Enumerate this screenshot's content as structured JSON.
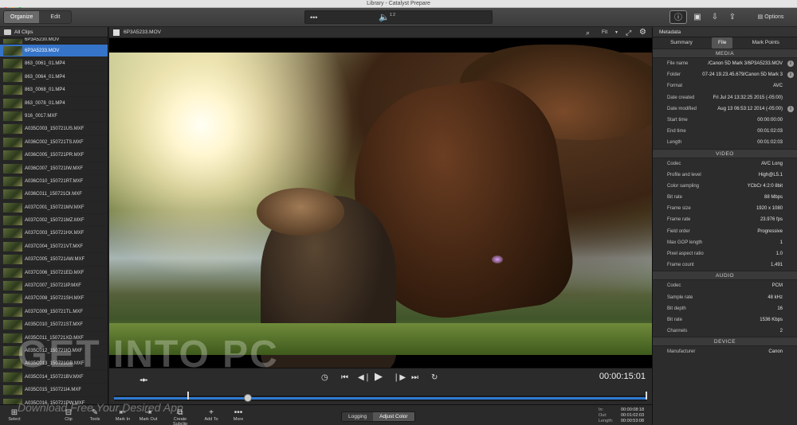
{
  "window": {
    "title": "Library - Catalyst Prepare"
  },
  "toolbar": {
    "modes": [
      "Organize",
      "Edit"
    ],
    "active_mode": "Organize",
    "center_more": "•••",
    "options_label": "Options",
    "audio_channels": "1 2"
  },
  "sidebar": {
    "header": "All Clips",
    "clips": [
      "6P3A5230.MOV",
      "6P3A5233.MOV",
      "863_0061_01.MP4",
      "863_0064_01.MP4",
      "863_0068_01.MP4",
      "863_0078_01.MP4",
      "916_0017.MXF",
      "A035C003_150721US.MXF",
      "A036C002_150721TS.MXF",
      "A036C005_150721PR.MXF",
      "A036C007_150721IW.MXF",
      "A036C010_150721RT.MXF",
      "A036C011_150721OI.MXF",
      "A037C001_150721MV.MXF",
      "A037C002_150721MZ.MXF",
      "A037C003_150721HX.MXF",
      "A037C004_150721VT.MXF",
      "A037C005_150721AW.MXF",
      "A037C006_150721ED.MXF",
      "A037C007_150721IP.MXF",
      "A037C008_150721SH.MXF",
      "A037C009_150721TL.MXF",
      "A035C010_150721ST.MXF",
      "A035C011_150721XD.MXF",
      "A035C012_150721IO.MXF",
      "A035C013_150721GB.MXF",
      "A035C014_150721BV.MXF",
      "A035C015_150721I4.MXF",
      "A035C016_150721PW.MXF"
    ],
    "selected_index": 1
  },
  "viewer": {
    "clip_name": "6P3A5233.MOV",
    "zoom": "Fit",
    "timecode": "00:00:15:01"
  },
  "bottom_tools": [
    {
      "label": "Select",
      "icon": "grid-icon"
    },
    {
      "label": "Clip",
      "icon": "clip-icon"
    },
    {
      "label": "Tools",
      "icon": "tools-icon"
    },
    {
      "label": "Mark In",
      "icon": "mark-in-icon"
    },
    {
      "label": "Mark Out",
      "icon": "mark-out-icon"
    },
    {
      "label": "Create Subclip",
      "icon": "subclip-icon"
    },
    {
      "label": "Add To",
      "icon": "plus-icon"
    },
    {
      "label": "More",
      "icon": "more-icon"
    }
  ],
  "modes": [
    "Logging",
    "Adjust Color"
  ],
  "active_bottom_mode": "Adjust Color",
  "io": {
    "in_label": "In:",
    "in": "00:00:08:18",
    "out_label": "Out:",
    "out": "00:01:02:03",
    "length_label": "Length:",
    "length": "00:00:53:08"
  },
  "metadata": {
    "title": "Metadata",
    "tabs": [
      "Summary",
      "File",
      "Mark Points"
    ],
    "active_tab": "File",
    "sections": [
      {
        "name": "MEDIA",
        "rows": [
          {
            "k": "File name",
            "v": "/Canon 5D Mark 3/6P3A5233.MOV",
            "info": true
          },
          {
            "k": "Folder",
            "v": "07-24 19.23.45.679/Canon 5D Mark 3",
            "info": true
          },
          {
            "k": "Format",
            "v": "AVC",
            "info": false
          },
          {
            "k": "Date created",
            "v": "Fri Jul 24 13:32:25 2015 (-05:00)",
            "info": false
          },
          {
            "k": "Date modified",
            "v": "Aug 13 06:53:12 2014 (-05:00)",
            "info": true
          },
          {
            "k": "Start time",
            "v": "00:00:00:00",
            "info": false
          },
          {
            "k": "End time",
            "v": "00:01:02:03",
            "info": false
          },
          {
            "k": "Length",
            "v": "00:01:02:03",
            "info": false
          }
        ]
      },
      {
        "name": "VIDEO",
        "rows": [
          {
            "k": "Codec",
            "v": "AVC Long",
            "info": false
          },
          {
            "k": "Profile and level",
            "v": "High@L5.1",
            "info": false
          },
          {
            "k": "Color sampling",
            "v": "YCbCr 4:2:0 8bit",
            "info": false
          },
          {
            "k": "Bit rate",
            "v": "88 Mbps",
            "info": false
          },
          {
            "k": "Frame size",
            "v": "1920 x 1080",
            "info": false
          },
          {
            "k": "Frame rate",
            "v": "23.976 fps",
            "info": false
          },
          {
            "k": "Field order",
            "v": "Progressive",
            "info": false
          },
          {
            "k": "Max GOP length",
            "v": "1",
            "info": false
          },
          {
            "k": "Pixel aspect ratio",
            "v": "1.0",
            "info": false
          },
          {
            "k": "Frame count",
            "v": "1,491",
            "info": false
          }
        ]
      },
      {
        "name": "AUDIO",
        "rows": [
          {
            "k": "Codec",
            "v": "PCM",
            "info": false
          },
          {
            "k": "Sample rate",
            "v": "48 kHz",
            "info": false
          },
          {
            "k": "Bit depth",
            "v": "16",
            "info": false
          },
          {
            "k": "Bit rate",
            "v": "1536 Kbps",
            "info": false
          },
          {
            "k": "Channels",
            "v": "2",
            "info": false
          }
        ]
      },
      {
        "name": "DEVICE",
        "rows": [
          {
            "k": "Manufacturer",
            "v": "Canon",
            "info": false
          }
        ]
      }
    ]
  },
  "watermark": {
    "main": "GET INTO PC",
    "sub": "Download Free Your Desired App"
  },
  "colors": {
    "accent": "#3574c9",
    "scrub": "#2f7bd1"
  }
}
